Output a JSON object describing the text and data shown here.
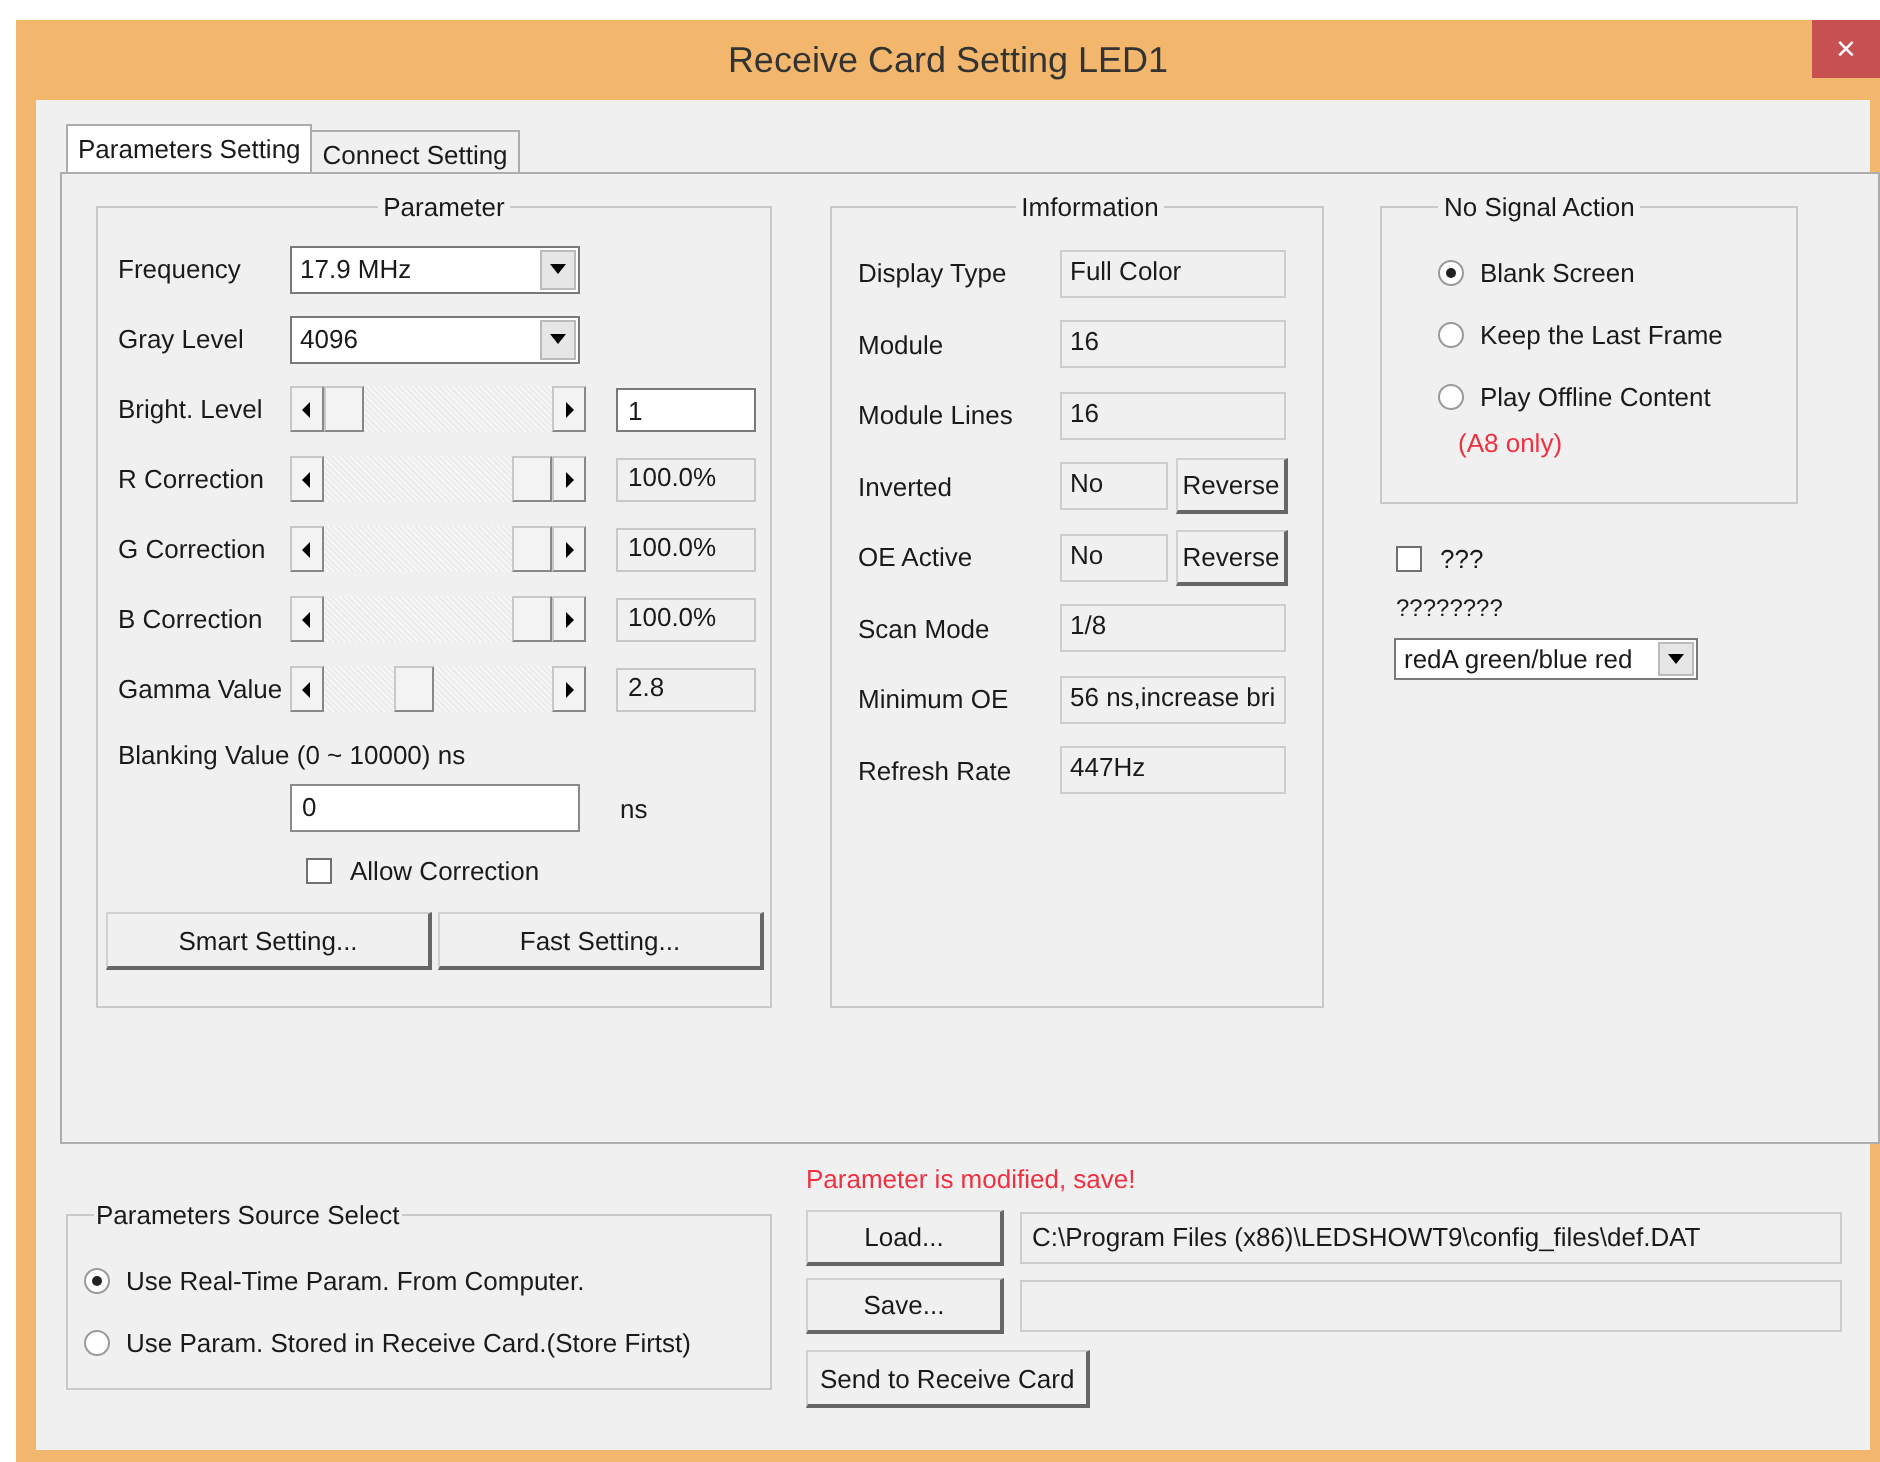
{
  "window": {
    "title": "Receive Card Setting LED1",
    "close": "×"
  },
  "tabs": [
    {
      "label": "Parameters Setting",
      "selected": true
    },
    {
      "label": "Connect Setting",
      "selected": false
    }
  ],
  "parameter": {
    "title": "Parameter",
    "rows": [
      {
        "kind": "select",
        "label": "Frequency",
        "value": "17.9 MHz"
      },
      {
        "kind": "select",
        "label": "Gray Level",
        "value": "4096"
      },
      {
        "kind": "slider",
        "label": "Bright. Level",
        "level": 0,
        "value": "1",
        "editable": true
      },
      {
        "kind": "slider",
        "label": "R Correction",
        "level": 1,
        "value": "100.0%",
        "editable": false
      },
      {
        "kind": "slider",
        "label": "G Correction",
        "level": 1,
        "value": "100.0%",
        "editable": false
      },
      {
        "kind": "slider",
        "label": "B Correction",
        "level": 1,
        "value": "100.0%",
        "editable": false
      },
      {
        "kind": "slider",
        "label": "Gamma Value",
        "level": 0.37,
        "value": "2.8",
        "editable": false
      }
    ],
    "blanking": {
      "label": "Blanking Value (0 ~ 10000) ns",
      "value": "0",
      "unit": "ns"
    },
    "allow_correction": {
      "label": "Allow Correction",
      "checked": false
    },
    "buttons": [
      "Smart Setting...",
      "Fast Setting..."
    ]
  },
  "information": {
    "title": "Imformation",
    "rows": [
      {
        "label": "Display Type",
        "value": "Full Color"
      },
      {
        "label": "Module",
        "value": "16"
      },
      {
        "label": "Module Lines",
        "value": "16"
      },
      {
        "label": "Inverted",
        "value": "No",
        "button": "Reverse"
      },
      {
        "label": "OE Active",
        "value": "No",
        "button": "Reverse"
      },
      {
        "label": "Scan Mode",
        "value": "1/8"
      },
      {
        "label": "Minimum OE",
        "value": "56 ns,increase bri"
      },
      {
        "label": "Refresh Rate",
        "value": "447Hz"
      }
    ]
  },
  "no_signal": {
    "title": "No Signal Action",
    "options": [
      {
        "label": "Blank Screen",
        "selected": true
      },
      {
        "label": "Keep the Last Frame",
        "selected": false
      },
      {
        "label": "Play Offline Content",
        "selected": false
      }
    ],
    "note": "(A8 only)"
  },
  "extra_checkbox": {
    "label": "???",
    "checked": false
  },
  "color_order": {
    "label": "????????",
    "value": "redA green/blue red"
  },
  "source": {
    "title": "Parameters Source Select",
    "options": [
      {
        "label": "Use Real-Time Param. From Computer.",
        "selected": true
      },
      {
        "label": "Use Param. Stored in Receive Card.(Store Firtst)",
        "selected": false
      }
    ]
  },
  "status": "Parameter is modified, save!",
  "file": {
    "load_button": "Load...",
    "path": "C:\\Program Files (x86)\\LEDSHOWT9\\config_files\\def.DAT",
    "save_button": "Save...",
    "send_button": "Send to Receive Card"
  }
}
